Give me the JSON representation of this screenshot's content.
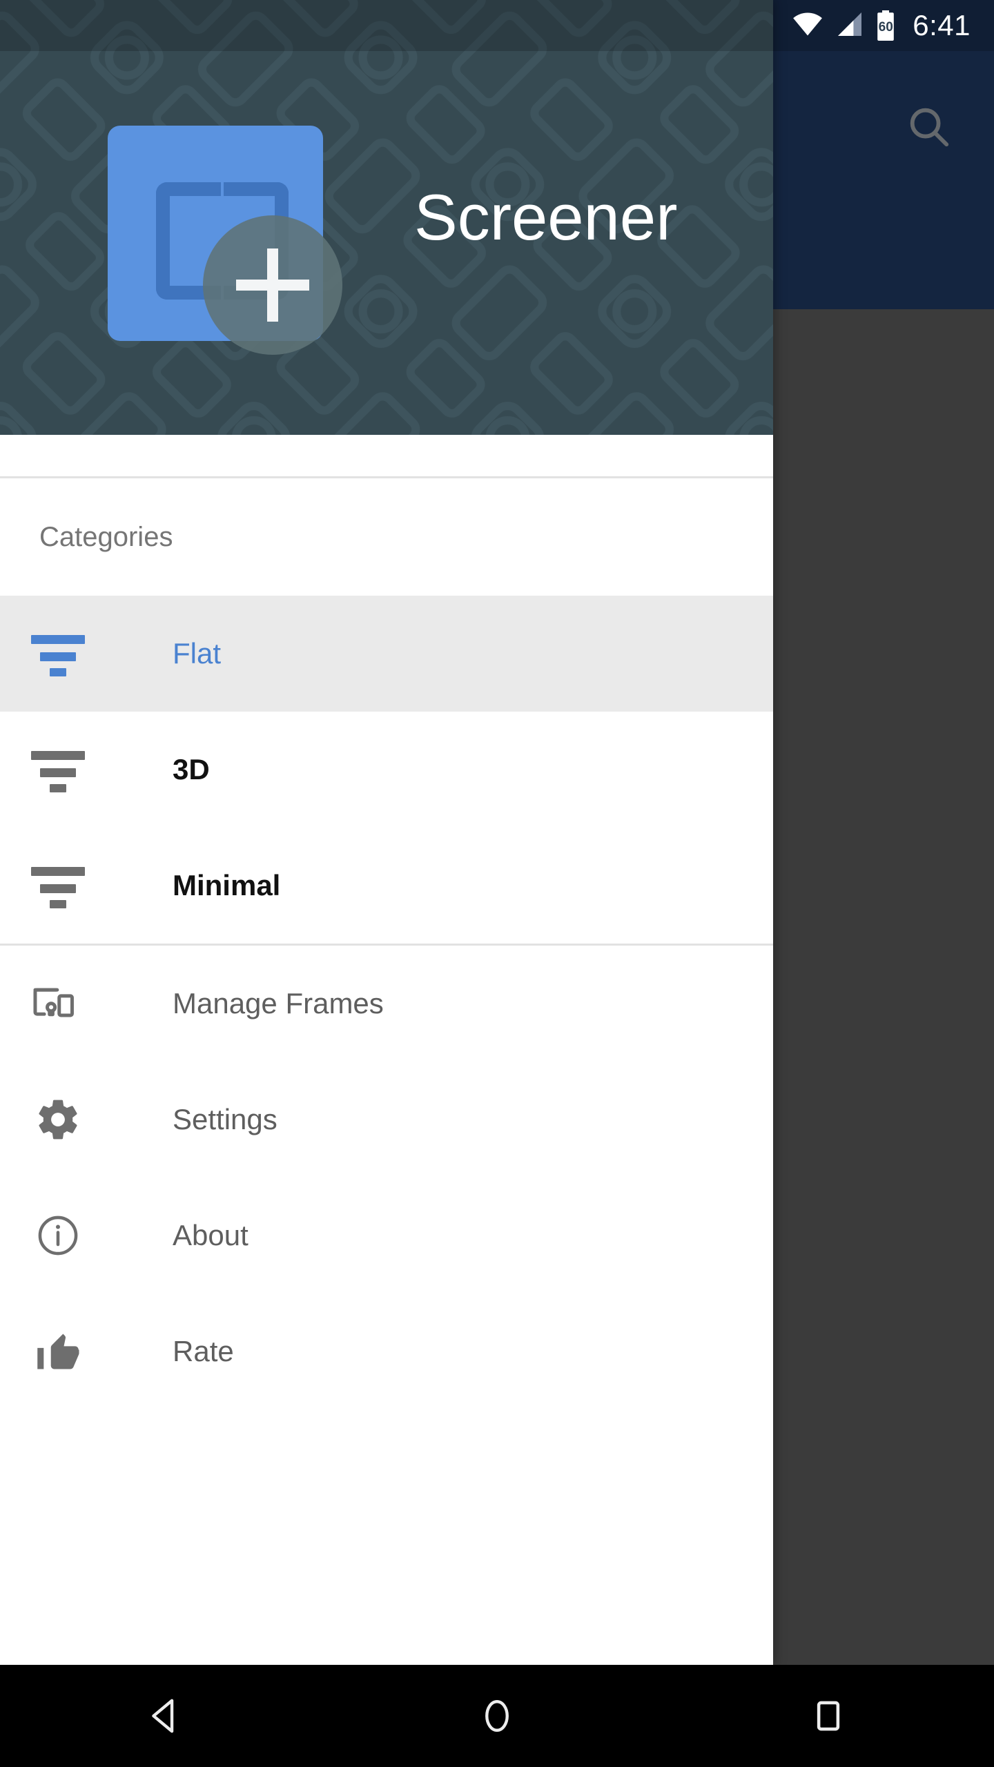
{
  "status_bar": {
    "time": "6:41",
    "battery_level": "60",
    "icons": [
      "wifi-icon",
      "cellular-signal-icon",
      "battery-icon"
    ]
  },
  "app": {
    "appbar_color": "#1F3A63",
    "search_icon": "search-icon",
    "scrim_color": "#5B5B5B"
  },
  "drawer": {
    "header": {
      "title": "Screener",
      "background_color": "#364A52",
      "icon": {
        "name": "screener-app-icon",
        "square_color": "#5B93E0",
        "bracket_color": "#3F74BE",
        "badge": "add-icon"
      }
    },
    "section_label": "Categories",
    "accent_color": "#4A82D0",
    "selected_row_color": "#EAEAEA",
    "categories": [
      {
        "label": "Flat",
        "icon": "filter-lines-icon",
        "selected": true
      },
      {
        "label": "3D",
        "icon": "filter-lines-icon",
        "selected": false
      },
      {
        "label": "Minimal",
        "icon": "filter-lines-icon",
        "selected": false
      }
    ],
    "menu": [
      {
        "label": "Manage Frames",
        "icon": "devices-icon"
      },
      {
        "label": "Settings",
        "icon": "gear-icon"
      },
      {
        "label": "About",
        "icon": "info-circle-icon"
      },
      {
        "label": "Rate",
        "icon": "thumb-up-icon"
      }
    ]
  },
  "navbar": {
    "back": "back-triangle-icon",
    "home": "home-circle-icon",
    "recents": "recents-square-icon"
  }
}
